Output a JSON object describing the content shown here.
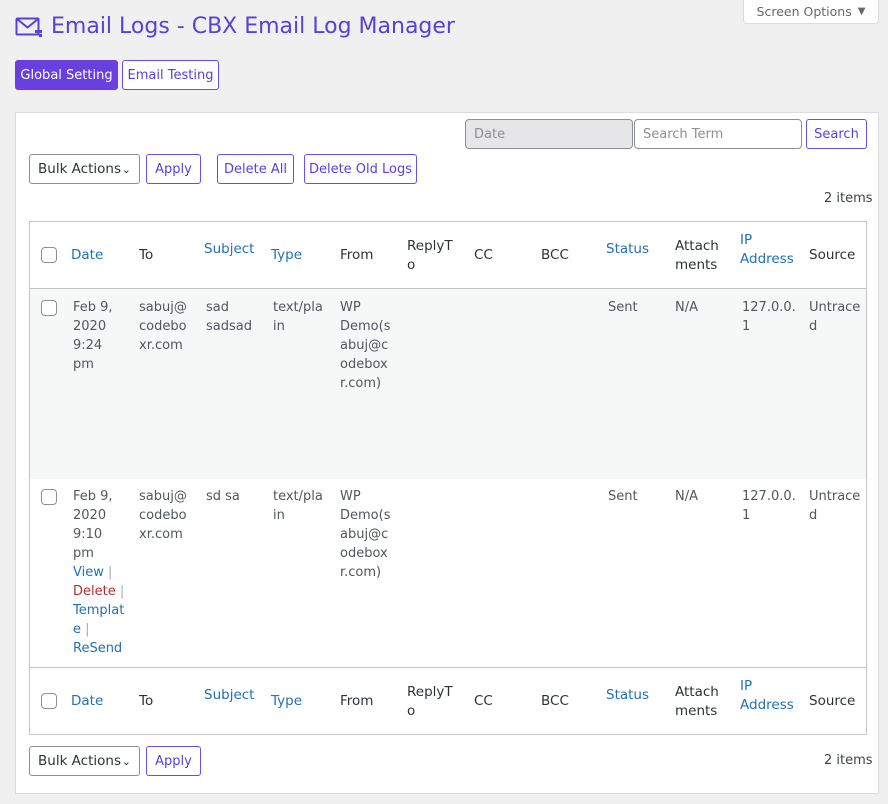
{
  "screen_options": {
    "label": "Screen Options"
  },
  "page": {
    "title": "Email Logs - CBX Email Log Manager"
  },
  "tabs": {
    "global_setting": "Global Setting",
    "email_testing": "Email Testing"
  },
  "filters": {
    "date_placeholder": "Date",
    "search_placeholder": "Search Term",
    "search_button": "Search"
  },
  "bulk": {
    "label": "Bulk Actions",
    "apply": "Apply",
    "delete_all": "Delete All",
    "delete_old": "Delete Old Logs"
  },
  "items_count": "2 items",
  "columns": {
    "date": "Date",
    "to": "To",
    "subject": "Subject",
    "type": "Type",
    "from": "From",
    "reply_to": [
      "ReplyT",
      "o"
    ],
    "cc": "CC",
    "bcc": "BCC",
    "status": "Status",
    "attachments": [
      "Attach",
      "ments"
    ],
    "ip": [
      "IP",
      "Address"
    ],
    "source": "Source"
  },
  "rows": [
    {
      "date": [
        "Feb 9,",
        "2020",
        "9:24",
        "pm"
      ],
      "to": [
        "sabuj@",
        "codebo",
        "xr.com"
      ],
      "subject": [
        "sad",
        "sadsad"
      ],
      "type": [
        "text/pla",
        "in"
      ],
      "from": [
        "WP",
        "Demo(s",
        "abuj@c",
        "odebox",
        "r.com)"
      ],
      "status": "Sent",
      "attachments": "N/A",
      "ip": [
        "127.0.0.",
        "1"
      ],
      "source": [
        "Untrace",
        "d"
      ]
    },
    {
      "date": [
        "Feb 9,",
        "2020",
        "9:10",
        "pm"
      ],
      "to": [
        "sabuj@",
        "codebo",
        "xr.com"
      ],
      "subject": [
        "sd sa"
      ],
      "type": [
        "text/pla",
        "in"
      ],
      "from": [
        "WP",
        "Demo(s",
        "abuj@c",
        "odebox",
        "r.com)"
      ],
      "status": "Sent",
      "attachments": "N/A",
      "ip": [
        "127.0.0.",
        "1"
      ],
      "source": [
        "Untrace",
        "d"
      ],
      "actions": {
        "view": "View",
        "delete": "Delete",
        "template": [
          "Templat",
          "e"
        ],
        "resend": "ReSend",
        "sep": "|"
      }
    }
  ]
}
